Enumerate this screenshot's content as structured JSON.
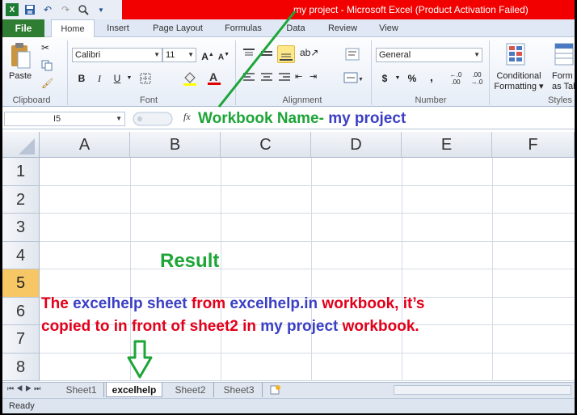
{
  "title_bar": {
    "text": "my project  -  Microsoft Excel (Product Activation Failed)"
  },
  "ribbon_tabs": [
    "File",
    "Home",
    "Insert",
    "Page Layout",
    "Formulas",
    "Data",
    "Review",
    "View"
  ],
  "ribbon": {
    "clipboard": {
      "paste": "Paste",
      "label": "Clipboard"
    },
    "font": {
      "name": "Calibri",
      "size": "11",
      "label": "Font",
      "bold": "B",
      "italic": "I",
      "underline": "U"
    },
    "alignment": {
      "label": "Alignment"
    },
    "number": {
      "format": "General",
      "label": "Number",
      "currency": "$",
      "percent": "%",
      "comma": ","
    },
    "styles": {
      "conditional_line1": "Conditional",
      "conditional_line2": "Formatting",
      "format_line1": "Form",
      "format_line2": "as Tab",
      "label": "Styles"
    }
  },
  "formula_bar": {
    "name_box": "I5",
    "fx": "fx",
    "annotation_prefix": "Workbook Name-",
    "annotation_name": "my project"
  },
  "columns": [
    "A",
    "B",
    "C",
    "D",
    "E",
    "F"
  ],
  "rows": [
    "1",
    "2",
    "3",
    "4",
    "5",
    "6",
    "7",
    "8"
  ],
  "annotations": {
    "result": "Result",
    "line1": [
      {
        "t": "The ",
        "c": "red"
      },
      {
        "t": "excelhelp sheet",
        "c": "blue"
      },
      {
        "t": "  from ",
        "c": "red"
      },
      {
        "t": "excelhelp.in",
        "c": "blue"
      },
      {
        "t": " workbook, it’s",
        "c": "red"
      }
    ],
    "line2": [
      {
        "t": "copied to in front of sheet2 in ",
        "c": "red"
      },
      {
        "t": "my project",
        "c": "blue"
      },
      {
        "t": " workbook.",
        "c": "red"
      }
    ]
  },
  "sheet_tabs": [
    "Sheet1",
    "excelhelp",
    "Sheet2",
    "Sheet3"
  ],
  "active_sheet": "excelhelp",
  "status": "Ready",
  "colors": {
    "accent_green": "#1ea538",
    "accent_blue": "#3b3fc4",
    "accent_red": "#e2001a",
    "title_red": "#f20000"
  }
}
